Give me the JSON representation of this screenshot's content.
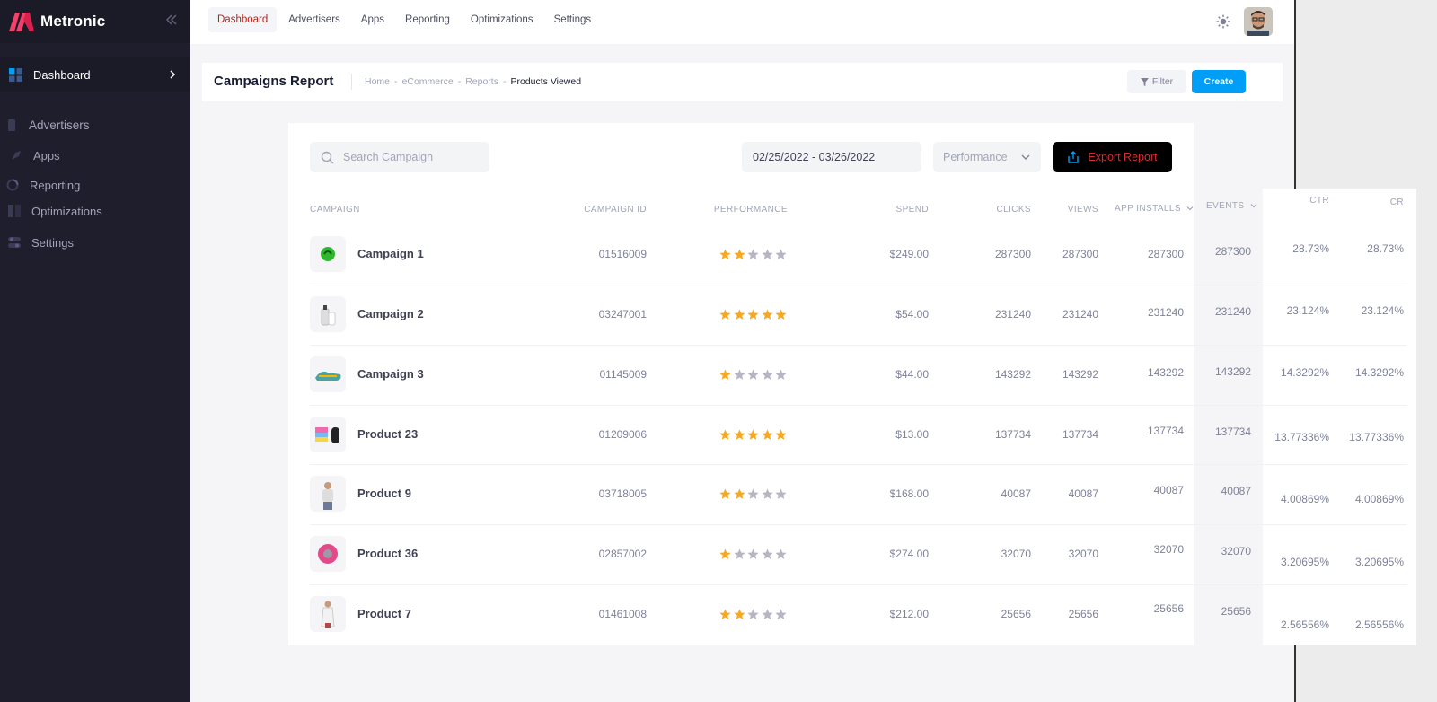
{
  "app": {
    "name": "Metronic"
  },
  "sidebar": {
    "active": {
      "label": "Dashboard",
      "icon": "dashboard-icon"
    },
    "items": [
      {
        "label": "Advertisers",
        "icon": "advertisers-icon"
      },
      {
        "label": "Apps",
        "icon": "rocket-icon"
      },
      {
        "label": "Reporting",
        "icon": "pie-chart-icon"
      },
      {
        "label": "Optimizations",
        "icon": "columns-icon"
      },
      {
        "label": "Settings",
        "icon": "toggle-icon"
      }
    ]
  },
  "topnav": {
    "tabs": [
      {
        "label": "Dashboard",
        "active": true
      },
      {
        "label": "Advertisers"
      },
      {
        "label": "Apps"
      },
      {
        "label": "Reporting"
      },
      {
        "label": "Optimizations"
      },
      {
        "label": "Settings"
      }
    ]
  },
  "toolbar": {
    "title": "Campaigns Report",
    "breadcrumb": [
      "Home",
      "eCommerce",
      "Reports",
      "Products Viewed"
    ],
    "filter_label": "Filter",
    "create_label": "Create"
  },
  "controls": {
    "search_placeholder": "Search Campaign",
    "date_range": "02/25/2022 - 03/26/2022",
    "performance_label": "Performance",
    "export_label": "Export Report"
  },
  "table": {
    "headers": {
      "campaign": "Campaign",
      "campaign_id": "Campaign ID",
      "performance": "Performance",
      "spend": "Spend",
      "clicks": "Clicks",
      "views": "Views",
      "app_installs": "App Installs",
      "events": "Events",
      "ctr": "CTR",
      "cr": "CR"
    },
    "rows": [
      {
        "name": "Campaign 1",
        "id": "01516009",
        "rating": 2,
        "spend": "$249.00",
        "clicks": "287300",
        "views": "287300",
        "installs": "287300",
        "events": "287300",
        "ctr": "28.73%",
        "cr": "28.73%",
        "thumb": "green-ball"
      },
      {
        "name": "Campaign 2",
        "id": "03247001",
        "rating": 5,
        "spend": "$54.00",
        "clicks": "231240",
        "views": "231240",
        "installs": "231240",
        "events": "231240",
        "ctr": "23.124%",
        "cr": "23.124%",
        "thumb": "bottles"
      },
      {
        "name": "Campaign 3",
        "id": "01145009",
        "rating": 1,
        "spend": "$44.00",
        "clicks": "143292",
        "views": "143292",
        "installs": "143292",
        "events": "143292",
        "ctr": "14.3292%",
        "cr": "14.3292%",
        "thumb": "sneaker"
      },
      {
        "name": "Product 23",
        "id": "01209006",
        "rating": 5,
        "spend": "$13.00",
        "clicks": "137734",
        "views": "137734",
        "installs": "137734",
        "events": "137734",
        "ctr": "13.77336%",
        "cr": "13.77336%",
        "thumb": "cups"
      },
      {
        "name": "Product 9",
        "id": "03718005",
        "rating": 2,
        "spend": "$168.00",
        "clicks": "40087",
        "views": "40087",
        "installs": "40087",
        "events": "40087",
        "ctr": "4.00869%",
        "cr": "4.00869%",
        "thumb": "person"
      },
      {
        "name": "Product 36",
        "id": "02857002",
        "rating": 1,
        "spend": "$274.00",
        "clicks": "32070",
        "views": "32070",
        "installs": "32070",
        "events": "32070",
        "ctr": "3.20695%",
        "cr": "3.20695%",
        "thumb": "pink-disc"
      },
      {
        "name": "Product 7",
        "id": "01461008",
        "rating": 2,
        "spend": "$212.00",
        "clicks": "25656",
        "views": "25656",
        "installs": "25656",
        "events": "25656",
        "ctr": "2.56556%",
        "cr": "2.56556%",
        "thumb": "dress"
      }
    ]
  },
  "colors": {
    "sidebar_bg": "#1e1e2d",
    "accent_red": "#b5231b",
    "primary_blue": "#009ef7",
    "star_on": "#f6a821",
    "star_off": "#b5b5c3"
  }
}
